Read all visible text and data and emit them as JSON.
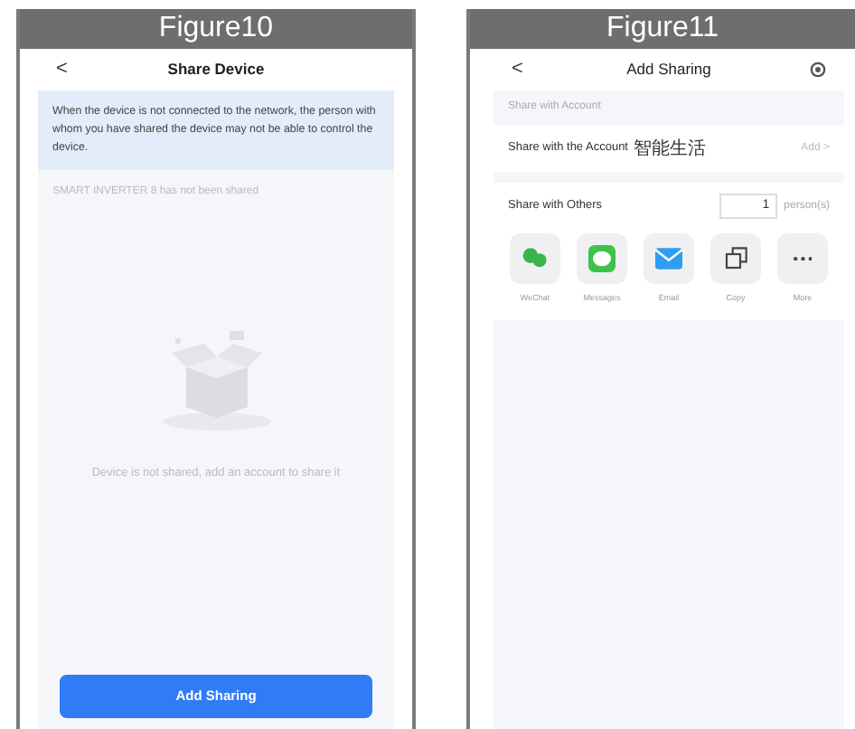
{
  "figure_10": {
    "caption": "Figure10",
    "nav": {
      "back": "<",
      "title": "Share Device"
    },
    "notice": "When the device is not connected to the network, the person with whom you have shared the device may not be able to control the device.",
    "status": "SMART INVERTER 8 has not been shared",
    "empty_message": "Device is not shared, add an account to share it",
    "button": "Add Sharing"
  },
  "figure_11": {
    "caption": "Figure11",
    "nav": {
      "back": "<",
      "title": "Add Sharing"
    },
    "account_section": "Share with Account",
    "account_row": {
      "label": "Share with the Account",
      "account_name": "智能生活",
      "action": "Add >"
    },
    "others_row": {
      "label": "Share with Others",
      "count": "1",
      "unit": "person(s)"
    },
    "share_targets": [
      {
        "kind": "chat",
        "label": "WeChat"
      },
      {
        "kind": "message",
        "label": "Messages"
      },
      {
        "kind": "mail",
        "label": "Email"
      },
      {
        "kind": "copy",
        "label": "Copy"
      },
      {
        "kind": "more",
        "label": "More"
      }
    ]
  }
}
